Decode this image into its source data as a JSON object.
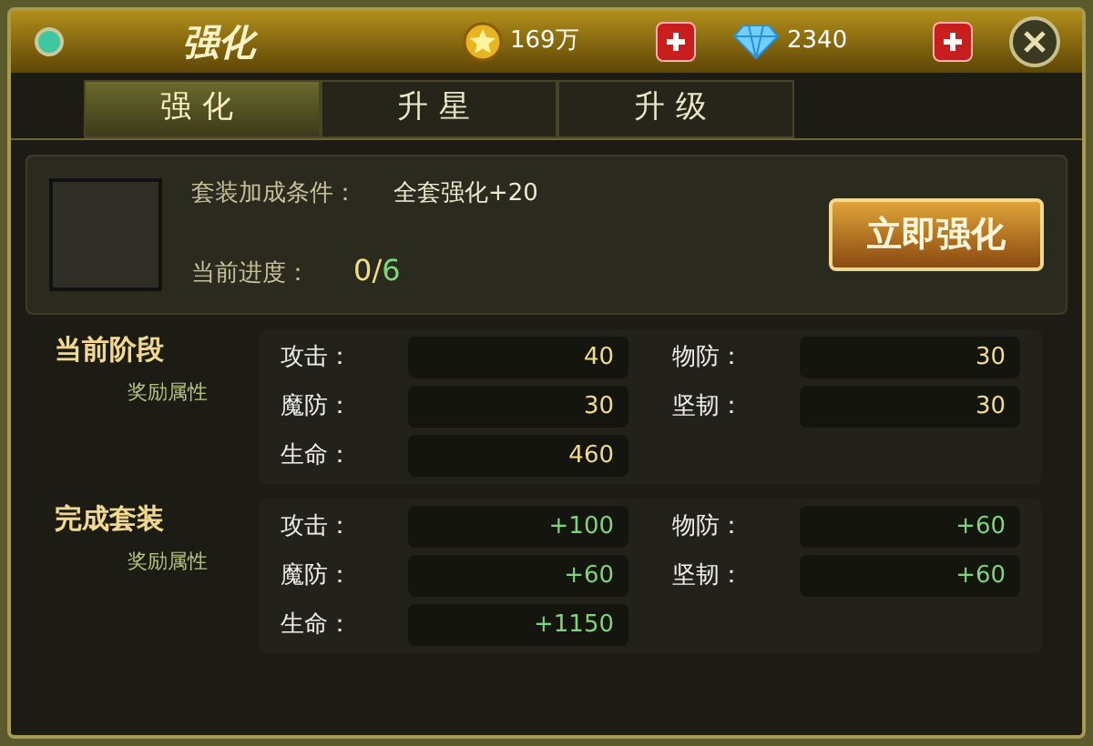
{
  "window": {
    "title": "强化"
  },
  "currencies": [
    {
      "kind": "gold",
      "amount": "169万"
    },
    {
      "kind": "gem",
      "amount": "2340"
    }
  ],
  "tabs": [
    {
      "label": "强化",
      "selected": true
    },
    {
      "label": "升星",
      "selected": false
    },
    {
      "label": "升级",
      "selected": false
    }
  ],
  "set_condition": {
    "label": "套装加成条件：",
    "value": "全套强化+20"
  },
  "progress": {
    "label": "当前进度：",
    "done": "0",
    "separator": "/",
    "total": "6"
  },
  "action_button": "立即强化",
  "sections": [
    {
      "kind": "current",
      "title": "当前阶段",
      "subtitle": "奖励属性",
      "stats": [
        {
          "label": "攻击：",
          "value": "40"
        },
        {
          "label": "物防：",
          "value": "30"
        },
        {
          "label": "魔防：",
          "value": "30"
        },
        {
          "label": "坚韧：",
          "value": "30"
        },
        {
          "label": "生命：",
          "value": "460"
        }
      ]
    },
    {
      "kind": "bonus",
      "title": "完成套装",
      "subtitle": "奖励属性",
      "stats": [
        {
          "label": "攻击：",
          "value": "+100"
        },
        {
          "label": "物防：",
          "value": "+60"
        },
        {
          "label": "魔防：",
          "value": "+60"
        },
        {
          "label": "坚韧：",
          "value": "+60"
        },
        {
          "label": "生命：",
          "value": "+1150"
        }
      ]
    }
  ]
}
